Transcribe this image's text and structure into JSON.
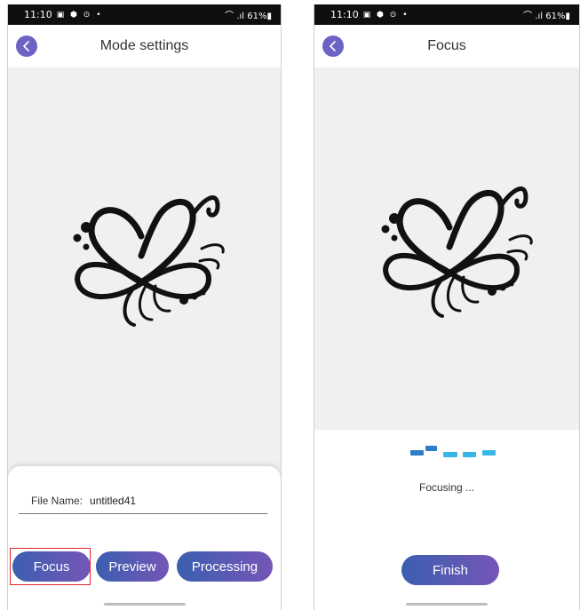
{
  "colors": {
    "accent_start": "#3b5fb0",
    "accent_end": "#7556b7",
    "back_button": "#6c63c5",
    "status_bar": "#0f0f0f",
    "canvas_bg": "#f0f0f0",
    "highlight": "#e0242a",
    "loader_dark": "#2f7cc9",
    "loader_light": "#38b6e8"
  },
  "left_screen": {
    "status": {
      "time": "11:10",
      "glyphs": "▣ ⬢ ⊙ •",
      "right": "⌒ .ıl 61%▮"
    },
    "header": {
      "back_icon": "chevron-left-icon",
      "title": "Mode settings"
    },
    "file": {
      "label": "File Name:",
      "value": "untitled41"
    },
    "buttons": {
      "focus": "Focus",
      "preview": "Preview",
      "processing": "Processing"
    }
  },
  "right_screen": {
    "status": {
      "time": "11:10",
      "glyphs": "▣ ⬢ ⊙ •",
      "right": "⌒ .ıl 61%▮"
    },
    "header": {
      "back_icon": "chevron-left-icon",
      "title": "Focus"
    },
    "loading_text": "Focusing ...",
    "finish_label": "Finish"
  }
}
